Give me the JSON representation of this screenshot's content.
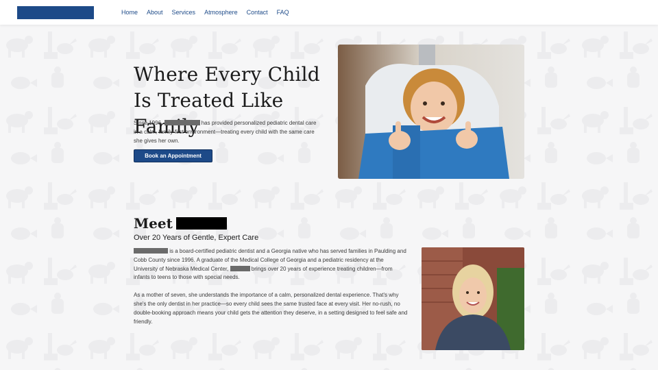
{
  "nav": {
    "items": [
      "Home",
      "About",
      "Services",
      "Atmosphere",
      "Contact",
      "FAQ"
    ]
  },
  "hero": {
    "title": "Where Every Child Is Treated Like Family",
    "text_before": "Since 1996,",
    "text_after": "has provided personalized pediatric dental care in a calm, family-first environment—treating every child with the same care she gives her own.",
    "cta_label": "Book an Appointment",
    "photo": "child-thumbs-up-in-dental-chair"
  },
  "meet": {
    "title_prefix": "Meet",
    "subtitle": "Over 20 Years of Gentle, Expert Care",
    "para1_a": "is a board-certified pediatric dentist and a Georgia native who has served families in Paulding and Cobb County since 1996. A graduate of the Medical College of Georgia and a pediatric residency at the University of Nebraska Medical Center,",
    "para1_b": "brings over 20 years of experience treating children—from infants to teens to those with special needs.",
    "para2": "As a mother of seven, she understands the importance of a calm, personalized dental experience. That's why she's the only dentist in her practice—so every child sees the same trusted face at every visit. Her no-rush, no double-booking approach means your child gets the attention they deserve, in a setting designed to feel safe and friendly.",
    "photo": "dentist-portrait"
  },
  "colors": {
    "brand": "#1d4a88",
    "background": "#f6f6f7",
    "redaction": "#6b6b6b"
  }
}
